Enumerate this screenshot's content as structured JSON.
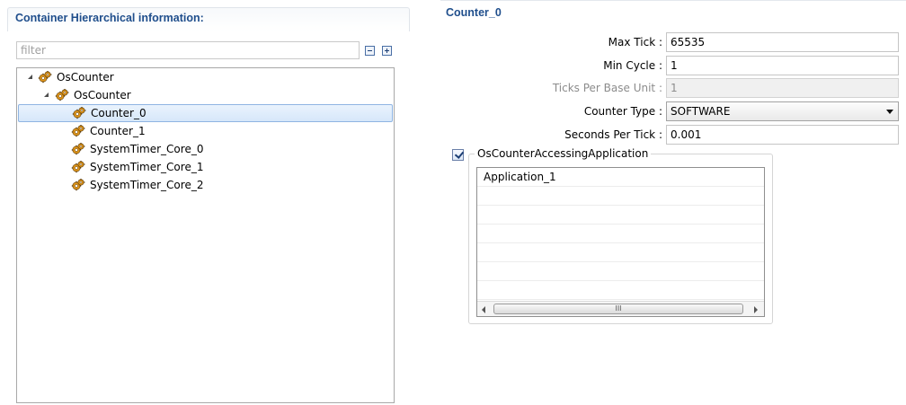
{
  "left_panel": {
    "title": "Container Hierarchical information:",
    "filter": {
      "placeholder": "filter",
      "value": ""
    },
    "toolbar": {
      "collapse_icon": "collapse-all-icon",
      "expand_icon": "expand-all-icon"
    },
    "tree": [
      {
        "label": "OsCounter",
        "icon": "gear-icon",
        "expanded": true
      },
      {
        "label": "OsCounter",
        "icon": "gear-icon",
        "expanded": true
      },
      {
        "label": "Counter_0",
        "icon": "gear-icon",
        "selected": true
      },
      {
        "label": "Counter_1",
        "icon": "gear-icon"
      },
      {
        "label": "SystemTimer_Core_0",
        "icon": "gear-icon"
      },
      {
        "label": "SystemTimer_Core_1",
        "icon": "gear-icon"
      },
      {
        "label": "SystemTimer_Core_2",
        "icon": "gear-icon"
      }
    ]
  },
  "right_panel": {
    "title": "Counter_0",
    "fields": {
      "max_tick": {
        "label": "Max Tick :",
        "value": "65535"
      },
      "min_cycle": {
        "label": "Min Cycle :",
        "value": "1"
      },
      "ticks_per_base": {
        "label": "Ticks Per Base Unit :",
        "value": "1",
        "disabled": true
      },
      "counter_type": {
        "label": "Counter Type :",
        "value": "SOFTWARE"
      },
      "seconds_per_tick": {
        "label": "Seconds Per Tick :",
        "value": "0.001"
      }
    },
    "accessing_group": {
      "label": "OsCounterAccessingApplication",
      "checked": true,
      "rows": [
        "Application_1",
        "",
        "",
        "",
        "",
        "",
        ""
      ],
      "scroll_thumb_grip": "III"
    }
  },
  "colors": {
    "title_blue": "#1f4e8c",
    "selection_bg": "#d6e7fa",
    "selection_border": "#8fb4e2",
    "gear_orange": "#e0961b"
  }
}
